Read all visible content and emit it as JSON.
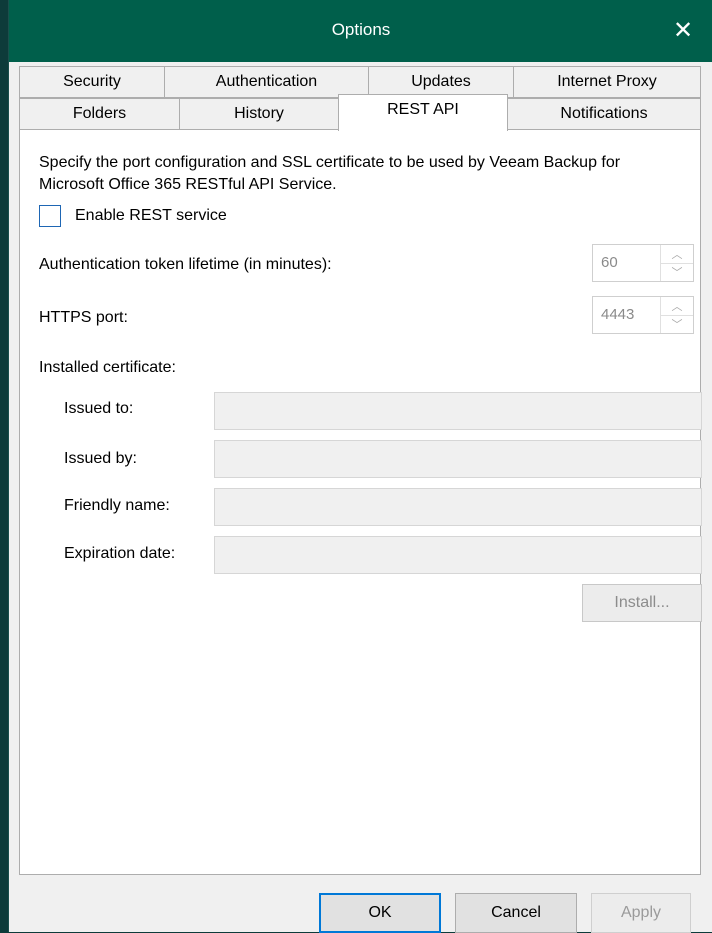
{
  "window": {
    "title": "Options",
    "close_icon": "close-icon"
  },
  "tabs": {
    "row1": [
      "Security",
      "Authentication",
      "Updates",
      "Internet Proxy"
    ],
    "row2": [
      "Folders",
      "History",
      "REST API",
      "Notifications"
    ],
    "active": "REST API"
  },
  "rest": {
    "description": "Specify the port configuration and SSL certificate to be used by Veeam Backup for Microsoft Office 365 RESTful API Service.",
    "enable_label": "Enable REST service",
    "enable_checked": false,
    "token_label": "Authentication token lifetime (in minutes):",
    "token_value": "60",
    "port_label": "HTTPS port:",
    "port_value": "4443",
    "cert_heading": "Installed certificate:",
    "issued_to_label": "Issued to:",
    "issued_to_value": "",
    "issued_by_label": "Issued by:",
    "issued_by_value": "",
    "friendly_name_label": "Friendly name:",
    "friendly_name_value": "",
    "expiration_label": "Expiration date:",
    "expiration_value": "",
    "install_label": "Install..."
  },
  "buttons": {
    "ok": "OK",
    "cancel": "Cancel",
    "apply": "Apply"
  },
  "colors": {
    "titlebar": "#005f4b",
    "background": "#0d3b3a",
    "focus": "#0078d7"
  }
}
